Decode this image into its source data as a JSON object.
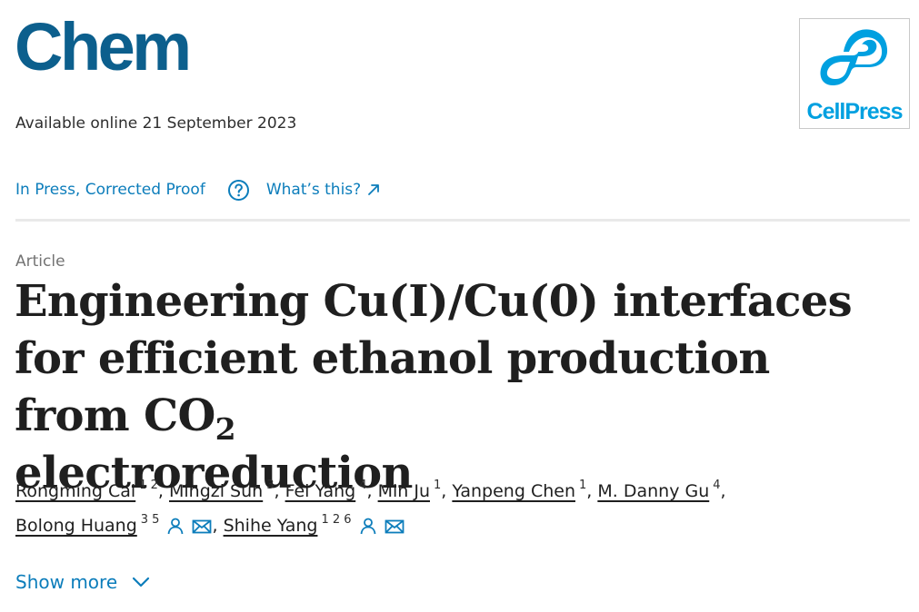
{
  "journal": {
    "name": "Chem"
  },
  "publisher": {
    "logo_text": "CellPress",
    "logo_color": "#00a0e0"
  },
  "availability": {
    "text": "Available online 21 September 2023"
  },
  "status": {
    "label": "In Press, Corrected Proof",
    "help_icon": "question-circle-icon",
    "whats_this_label": "What’s this?",
    "external_icon": "external-link-arrow-icon"
  },
  "article": {
    "type": "Article",
    "title_part1": "Engineering Cu(I)/Cu(0) interfaces for efficient ethanol production from CO",
    "title_subscript": "2",
    "title_part2": "electroreduction"
  },
  "authors": [
    {
      "name": "Rongming Cai",
      "affiliations": "1 2",
      "separator": ","
    },
    {
      "name": "Mingzi Sun",
      "affiliations": "3",
      "separator": ","
    },
    {
      "name": "Fei Yang",
      "affiliations": "4",
      "separator": ","
    },
    {
      "name": "Min Ju",
      "affiliations": "1",
      "separator": ","
    },
    {
      "name": "Yanpeng Chen",
      "affiliations": "1",
      "separator": ","
    },
    {
      "name": "M. Danny Gu",
      "affiliations": "4",
      "separator": ","
    },
    {
      "name": "Bolong Huang",
      "affiliations": "3 5",
      "separator": ",",
      "icons": [
        "person-icon",
        "envelope-icon"
      ]
    },
    {
      "name": "Shihe Yang",
      "affiliations": "1 2 6",
      "separator": "",
      "icons": [
        "person-icon",
        "envelope-icon"
      ]
    }
  ],
  "show_more": {
    "label": "Show more",
    "icon": "chevron-down-icon"
  },
  "colors": {
    "brand": "#0c5f8d",
    "link": "#0c7dbb",
    "divider": "#e9e9e9",
    "text": "#2e2e2e"
  }
}
